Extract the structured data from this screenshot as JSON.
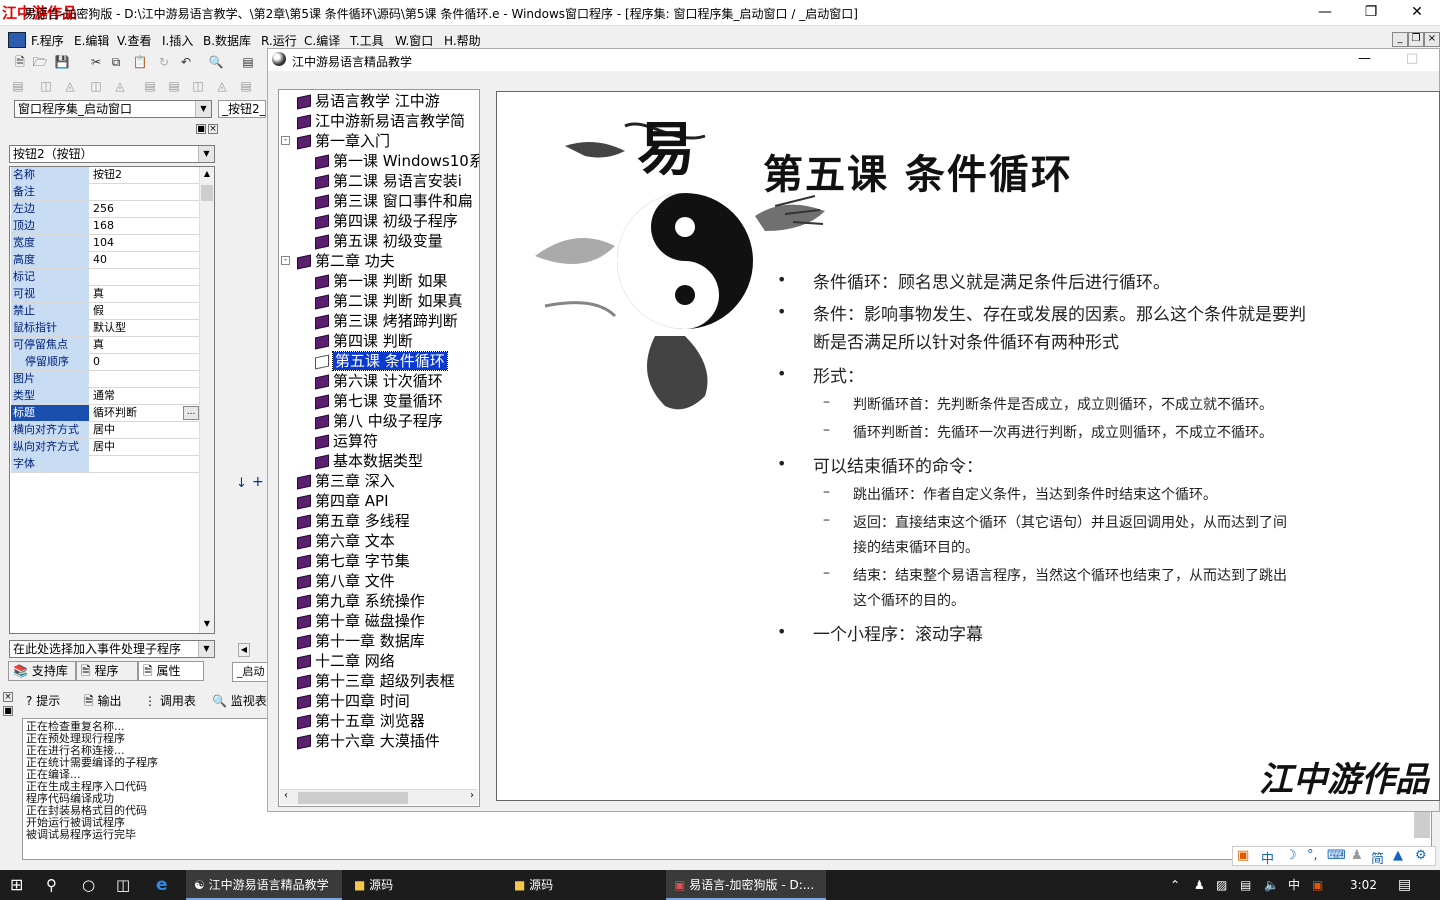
{
  "app": {
    "watermark": "江中游作品",
    "title": "易语言-加密狗版 - D:\\江中游易语言教学、\\第2章\\第5课 条件循环\\源码\\第5课 条件循环.e - Windows窗口程序 - [程序集: 窗口程序集_启动窗口 / _启动窗口]"
  },
  "menu": [
    "F.程序",
    "E.编辑",
    "V.查看",
    "I.插入",
    "B.数据库",
    "R.运行",
    "C.编译",
    "T.工具",
    "W.窗口",
    "H.帮助"
  ],
  "left": {
    "assembly_combo": "窗口程序集_启动窗口",
    "tab_small": "_按钮2_",
    "object_combo": "按钮2（按钮）",
    "properties": [
      {
        "k": "名称",
        "v": "按钮2"
      },
      {
        "k": "备注",
        "v": ""
      },
      {
        "k": "左边",
        "v": "256"
      },
      {
        "k": "顶边",
        "v": "168"
      },
      {
        "k": "宽度",
        "v": "104"
      },
      {
        "k": "高度",
        "v": "40"
      },
      {
        "k": "标记",
        "v": ""
      },
      {
        "k": "可视",
        "v": "真"
      },
      {
        "k": "禁止",
        "v": "假"
      },
      {
        "k": "鼠标指针",
        "v": "默认型"
      },
      {
        "k": "可停留焦点",
        "v": "真"
      },
      {
        "k": "停留顺序",
        "v": "0"
      },
      {
        "k": "图片",
        "v": ""
      },
      {
        "k": "类型",
        "v": "通常"
      },
      {
        "k": "标题",
        "v": "循环判断"
      },
      {
        "k": "横向对齐方式",
        "v": "居中"
      },
      {
        "k": "纵向对齐方式",
        "v": "居中"
      },
      {
        "k": "字体",
        "v": ""
      }
    ],
    "event_combo": "在此处选择加入事件处理子程序",
    "tabs": [
      "支持库",
      "程序",
      "属性"
    ],
    "right_tab": "_启动"
  },
  "bottom": {
    "tabs": [
      "提示",
      "输出",
      "调用表",
      "监视表"
    ],
    "output_lines": [
      "正在检查重复名称...",
      "正在预处理现行程序",
      "正在进行名称连接...",
      "正在统计需要编译的子程序",
      "正在编译...",
      "正在生成主程序入口代码",
      "程序代码编译成功",
      "正在封装易格式目的代码",
      "开始运行被调试程序",
      "被调试易程序运行完毕"
    ]
  },
  "inner": {
    "title": "江中游易语言精品教学",
    "tree": [
      {
        "label": "易语言教学  江中游",
        "level": 0
      },
      {
        "label": "江中游新易语言教学简",
        "level": 0
      },
      {
        "label": "第一章入门",
        "level": 0,
        "expand": "-"
      },
      {
        "label": "第一课 Windows10系",
        "level": 1
      },
      {
        "label": "第二课  易语言安装i",
        "level": 1
      },
      {
        "label": "第三课 窗口事件和扁",
        "level": 1
      },
      {
        "label": "第四课 初级子程序",
        "level": 1
      },
      {
        "label": "第五课 初级变量",
        "level": 1
      },
      {
        "label": "第二章 功夫",
        "level": 0,
        "expand": "-"
      },
      {
        "label": "第一课 判断 如果",
        "level": 1
      },
      {
        "label": "第二课 判断 如果真",
        "level": 1
      },
      {
        "label": "第三课 烤猪蹄判断",
        "level": 1
      },
      {
        "label": "第四课 判断",
        "level": 1
      },
      {
        "label": "第五课 条件循环",
        "level": 1,
        "selected": true
      },
      {
        "label": "第六课 计次循环",
        "level": 1
      },
      {
        "label": "第七课 变量循环",
        "level": 1
      },
      {
        "label": "第八 中级子程序",
        "level": 1
      },
      {
        "label": "运算符",
        "level": 1
      },
      {
        "label": "基本数据类型",
        "level": 1
      },
      {
        "label": "第三章 深入",
        "level": 0
      },
      {
        "label": "第四章 API",
        "level": 0
      },
      {
        "label": "第五章 多线程",
        "level": 0
      },
      {
        "label": "第六章 文本",
        "level": 0
      },
      {
        "label": "第七章 字节集",
        "level": 0
      },
      {
        "label": "第八章 文件",
        "level": 0
      },
      {
        "label": "第九章 系统操作",
        "level": 0
      },
      {
        "label": "第十章 磁盘操作",
        "level": 0
      },
      {
        "label": "第十一章 数据库",
        "level": 0
      },
      {
        "label": "十二章 网络",
        "level": 0
      },
      {
        "label": "第十三章 超级列表框",
        "level": 0
      },
      {
        "label": "第十四章 时间",
        "level": 0
      },
      {
        "label": "第十五章 浏览器",
        "level": 0
      },
      {
        "label": "第十六章 大漠插件",
        "level": 0
      }
    ],
    "slide": {
      "logo_char": "易",
      "title": "第五课 条件循环",
      "b1": "条件循环：顾名思义就是满足条件后进行循环。",
      "b2a": "条件：影响事物发生、存在或发展的因素。那么这个条件就是要判",
      "b2b": "断是否满足所以针对条件循环有两种形式",
      "b3": "形式：",
      "s1": "判断循环首：先判断条件是否成立，成立则循环，不成立就不循环。",
      "s2": "循环判断首：先循环一次再进行判断，成立则循环，不成立不循环。",
      "b4": "可以结束循环的命令：",
      "s3": "跳出循环：作者自定义条件，当达到条件时结束这个循环。",
      "s4a": "返回：直接结束这个循环（其它语句）并且返回调用处，从而达到了间",
      "s4b": "接的结束循环目的。",
      "s5a": "结束：结束整个易语言程序，当然这个循环也结束了，从而达到了跳出",
      "s5b": "这个循环的目的。",
      "b5": "一个小程序：滚动字幕",
      "signature": "江中游作品"
    }
  },
  "taskbar": {
    "items": [
      "江中游易语言精品教学",
      "源码",
      "源码",
      "易语言-加密狗版 - D:..."
    ],
    "tray_ime": "中",
    "clock": "3:02"
  },
  "ime_bar": [
    "中",
    "简"
  ]
}
